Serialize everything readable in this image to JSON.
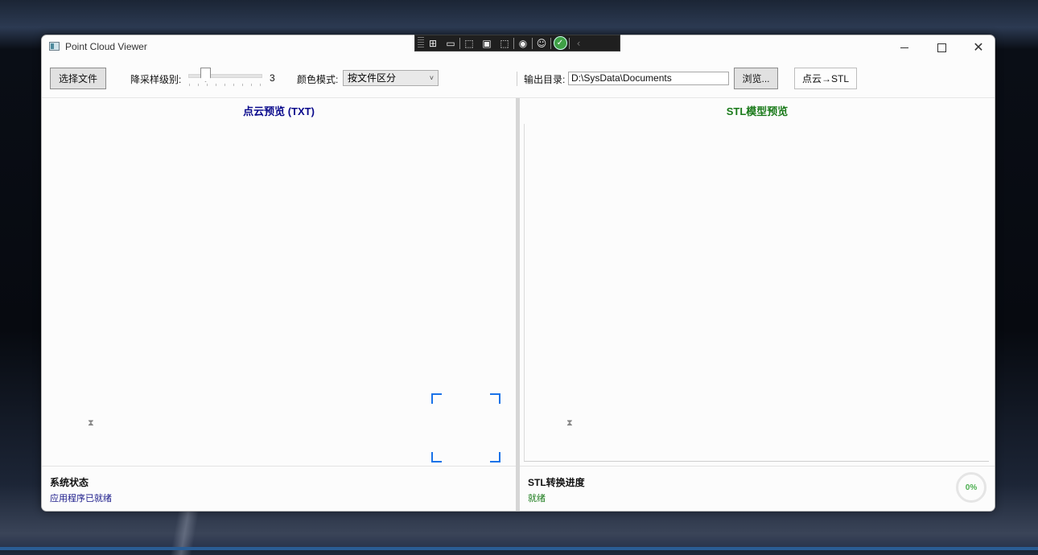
{
  "window": {
    "title": "Point Cloud Viewer"
  },
  "toolbar": {
    "select_file_label": "选择文件",
    "downsample_label": "降采样级别:",
    "downsample_value": "3",
    "color_mode_label": "颜色模式:",
    "color_mode_selected": "按文件区分",
    "output_dir_label": "输出目录:",
    "output_dir_value": "D:\\SysData\\Documents",
    "browse_label": "浏览...",
    "convert_label": "点云→STL"
  },
  "left_panel": {
    "title": "点云预览 (TXT)",
    "title_color": "#0a0a8c",
    "status_title": "系统状态",
    "status_text": "应用程序已就绪",
    "status_color": "#1a1a8a"
  },
  "right_panel": {
    "title": "STL模型预览",
    "title_color": "#1a7a1a",
    "status_title": "STL转换进度",
    "status_text": "就绪",
    "status_color": "#1a7a1a",
    "progress_text": "0%",
    "progress_value": 0
  },
  "overlay_toolbar": {
    "icons": [
      "live-tree-icon",
      "record-icon",
      "select-element-icon",
      "display-layout-adorners-icon",
      "track-focused-icon",
      "hot-reload-icon",
      "accessibility-icon",
      "ok-status-icon",
      "collapse-icon"
    ]
  },
  "colors": {
    "accent": "#1a73e8"
  }
}
